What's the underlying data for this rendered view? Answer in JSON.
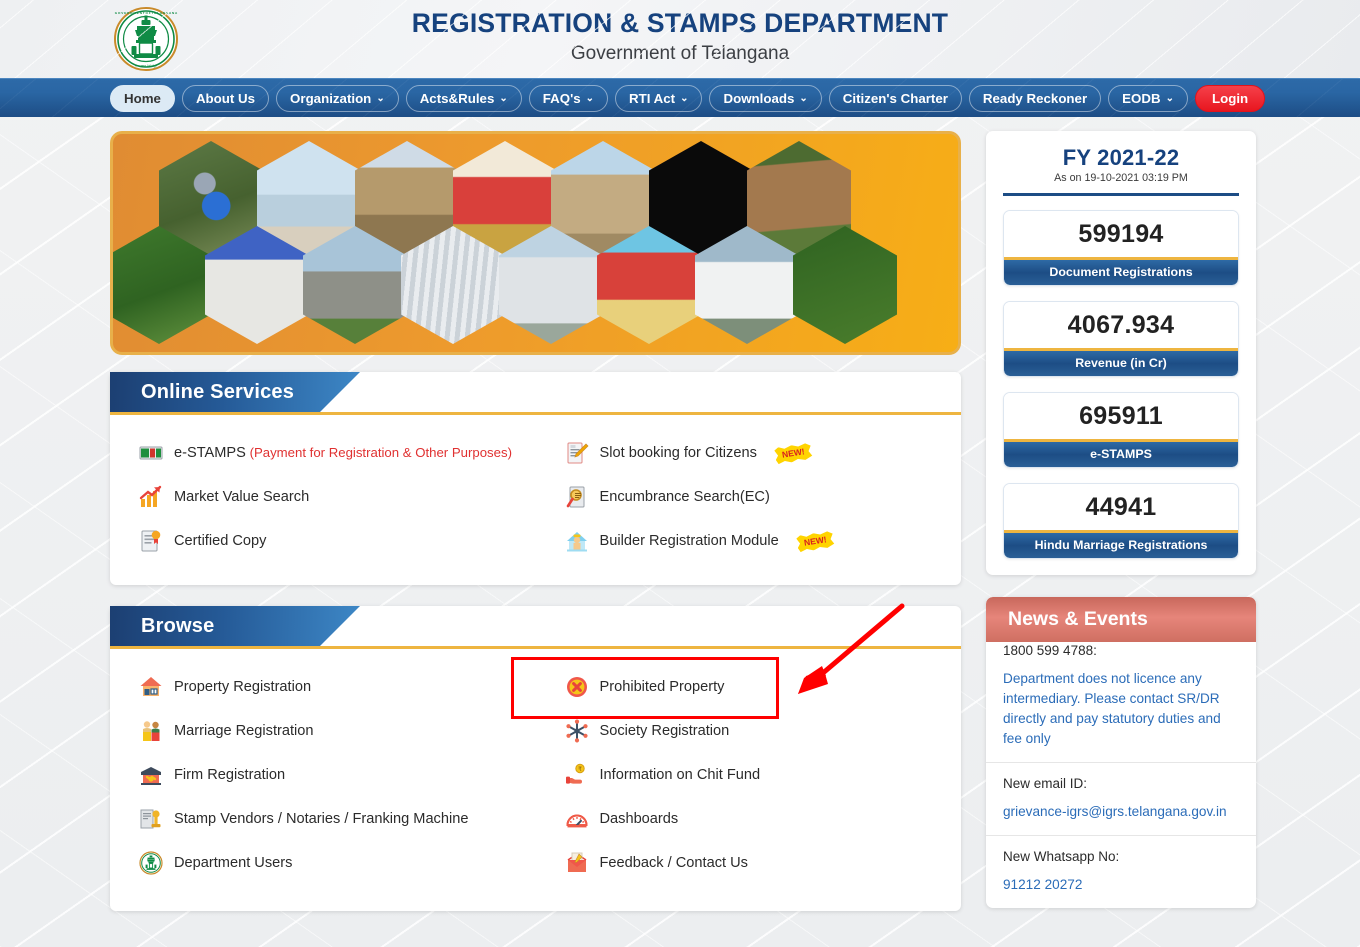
{
  "header": {
    "logo_alt": "Government of Telangana Emblem",
    "emblem_text": "GOVERNMENT OF TELANGANA",
    "title": "REGISTRATION & STAMPS DEPARTMENT",
    "subtitle": "Government of Telangana"
  },
  "nav": {
    "items": [
      {
        "label": "Home",
        "caret": false,
        "active": true,
        "login": false
      },
      {
        "label": "About Us",
        "caret": false,
        "active": false,
        "login": false
      },
      {
        "label": "Organization",
        "caret": true,
        "active": false,
        "login": false
      },
      {
        "label": "Acts&Rules",
        "caret": true,
        "active": false,
        "login": false
      },
      {
        "label": "FAQ's",
        "caret": true,
        "active": false,
        "login": false
      },
      {
        "label": "RTI Act",
        "caret": true,
        "active": false,
        "login": false
      },
      {
        "label": "Downloads",
        "caret": true,
        "active": false,
        "login": false
      },
      {
        "label": "Citizen's Charter",
        "caret": false,
        "active": false,
        "login": false
      },
      {
        "label": "Ready Reckoner",
        "caret": false,
        "active": false,
        "login": false
      },
      {
        "label": "EODB",
        "caret": true,
        "active": false,
        "login": false
      },
      {
        "label": "Login",
        "caret": false,
        "active": false,
        "login": true
      }
    ],
    "caret_glyph": "⌄"
  },
  "banner": {
    "alt": "Telangana heritage and wildlife hexagon photo collage",
    "tiles_top": [
      "bird",
      "buddha-statue",
      "golconda-fort",
      "goddess-bathukamma",
      "charminar",
      "indian-flag",
      "spotted-deer"
    ],
    "tiles_bottom": [
      "green-plant",
      "yadadri-temple",
      "ancient-pillars",
      "waterfall-sheet",
      "palace",
      "bonalu-festival",
      "waterfall",
      "yellow-flowers"
    ]
  },
  "online_services": {
    "heading": "Online Services",
    "left_items": [
      {
        "label": "e-STAMPS",
        "sub": "(Payment for Registration & Other Purposes)",
        "icon": "estamps-icon",
        "new": false
      },
      {
        "label": "Market Value Search",
        "sub": "",
        "icon": "chart-up-icon",
        "new": false
      },
      {
        "label": "Certified Copy",
        "sub": "",
        "icon": "certificate-icon",
        "new": false
      }
    ],
    "right_items": [
      {
        "label": "Slot booking for Citizens",
        "sub": "",
        "icon": "document-pen-icon",
        "new": true
      },
      {
        "label": "Encumbrance Search(EC)",
        "sub": "",
        "icon": "magnifier-document-icon",
        "new": false
      },
      {
        "label": "Builder Registration Module",
        "sub": "",
        "icon": "builder-house-icon",
        "new": true
      }
    ],
    "new_badge": "NEW!"
  },
  "browse": {
    "heading": "Browse",
    "left_items": [
      {
        "label": "Property Registration",
        "icon": "house-icon"
      },
      {
        "label": "Marriage Registration",
        "icon": "couple-icon"
      },
      {
        "label": "Firm Registration",
        "icon": "handshake-icon"
      },
      {
        "label": "Stamp Vendors / Notaries / Franking Machine",
        "icon": "stamp-icon"
      },
      {
        "label": "Department Users",
        "icon": "telangana-emblem-icon"
      }
    ],
    "right_items": [
      {
        "label": "Prohibited Property",
        "icon": "red-cross-circle-icon",
        "highlighted": true
      },
      {
        "label": "Society Registration",
        "icon": "society-network-icon",
        "highlighted": false
      },
      {
        "label": "Information on Chit Fund",
        "icon": "hand-coin-icon",
        "highlighted": false
      },
      {
        "label": "Dashboards",
        "icon": "gauge-icon",
        "highlighted": false
      },
      {
        "label": "Feedback / Contact Us",
        "icon": "feedback-box-icon",
        "highlighted": false
      }
    ]
  },
  "annotation": {
    "highlight_color": "#ff0000",
    "arrow_color": "#ff0000",
    "target": "Prohibited Property"
  },
  "stats": {
    "fy_title": "FY 2021-22",
    "as_on": "As on 19-10-2021 03:19 PM",
    "items": [
      {
        "value": "599194",
        "label": "Document Registrations"
      },
      {
        "value": "4067.934",
        "label": "Revenue (in Cr)"
      },
      {
        "value": "695911",
        "label": "e-STAMPS"
      },
      {
        "value": "44941",
        "label": "Hindu Marriage Registrations"
      }
    ]
  },
  "news": {
    "heading": "News & Events",
    "items": [
      {
        "plain": "1800 599 4788:",
        "link": "Department does not licence any intermediary.  Please contact SR/DR directly and pay statutory duties and fee only"
      },
      {
        "plain": "New email ID:",
        "link": "grievance-igrs@igrs.telangana.gov.in"
      },
      {
        "plain": "New Whatsapp No:",
        "link": "91212 20272"
      }
    ]
  },
  "colors": {
    "brand_blue": "#16427e",
    "nav_blue": "#2a66a4",
    "accent_gold": "#eeb540",
    "banner_orange": "#ed9a2d",
    "news_red": "#cf6f62",
    "login_red": "#e8161f",
    "link_blue": "#2b6cb8",
    "alert_red": "#e03131"
  }
}
